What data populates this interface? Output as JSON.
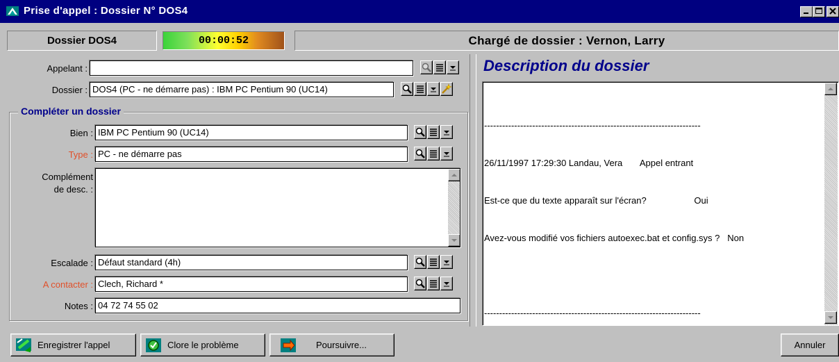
{
  "window": {
    "title": "Prise d'appel : Dossier N° DOS4"
  },
  "status": {
    "dossier_label": "Dossier DOS4",
    "timer": "00:00:52",
    "charge_label": "Chargé de dossier : Vernon, Larry"
  },
  "form": {
    "appelant_label": "Appelant :",
    "appelant_value": "",
    "dossier_label": "Dossier :",
    "dossier_value": "DOS4 (PC - ne démarre pas) : IBM PC Pentium 90 (UC14)",
    "group_title": "Compléter un dossier",
    "bien_label": "Bien :",
    "bien_value": "IBM PC Pentium 90 (UC14)",
    "type_label": "Type :",
    "type_value": "PC - ne démarre pas",
    "complement_label_1": "Complément",
    "complement_label_2": "de desc. :",
    "complement_value": "",
    "escalade_label": "Escalade :",
    "escalade_value": "Défaut standard (4h)",
    "contact_label": "A contacter :",
    "contact_value": "Clech, Richard *",
    "notes_label": "Notes :",
    "notes_value": "04 72 74 55 02"
  },
  "description": {
    "title": "Description du dossier",
    "lines": [
      "------------------------------------------------------------------------",
      "26/11/1997 17:29:30 Landau, Vera       Appel entrant",
      "Est-ce que du texte apparaît sur l'écran?                   Oui",
      "Avez-vous modifié vos fichiers autoexec.bat et config.sys ?   Non",
      "",
      "------------------------------------------------------------------------"
    ]
  },
  "buttons": {
    "save": "Enregistrer l'appel",
    "close_problem": "Clore le problème",
    "continue": "Poursuivre...",
    "cancel": "Annuler"
  },
  "colors": {
    "titlebar": "#000080",
    "required_label": "#e0502a",
    "description_title": "#00008b"
  }
}
